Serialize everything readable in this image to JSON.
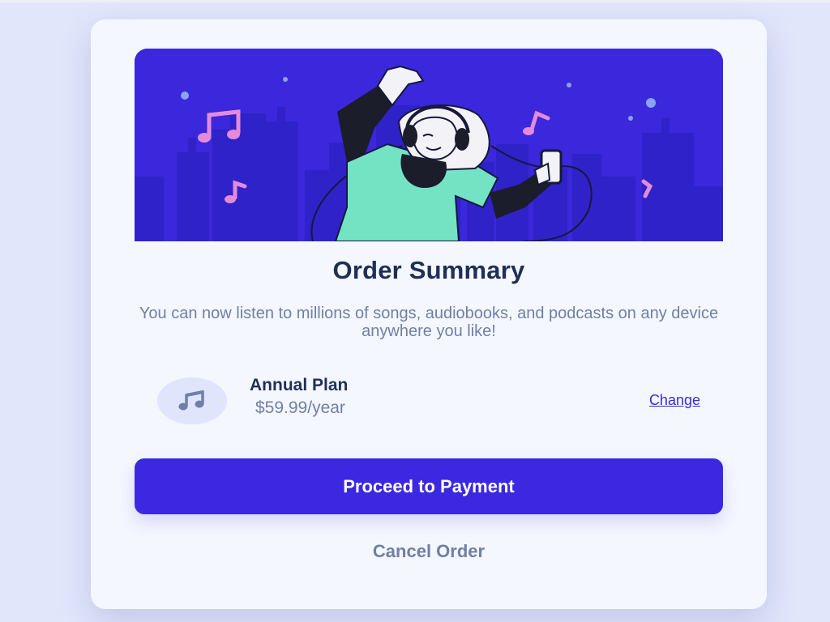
{
  "card": {
    "title": "Order Summary",
    "description": "You can now listen to millions of songs, audiobooks, and podcasts on any device anywhere you like!",
    "plan": {
      "icon": "music-note-icon",
      "name": "Annual Plan",
      "price": "$59.99/year",
      "change_label": "Change"
    },
    "primary_button": "Proceed to Payment",
    "cancel_button": "Cancel Order"
  },
  "hero": {
    "illustration": "woman-dancing-with-headphones-illustration"
  },
  "colors": {
    "accent": "#3b28e0",
    "title": "#1f2f56",
    "muted": "#717fa6",
    "background": "#e1e6fb",
    "card": "#f4f7fe"
  }
}
